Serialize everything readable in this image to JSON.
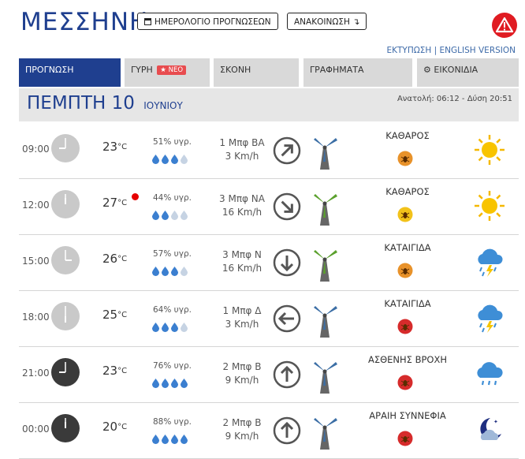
{
  "page": {
    "title": "ΜΕΣΣΗΝΗ",
    "calendar_button": "ΗΜΕΡΟΛΟΓΙΟ ΠΡΟΓΝΩΣΕΩΝ",
    "announcement_button": "ΑΝΑΚΟΙΝΩΣΗ",
    "print_link": "ΕΚΤΥΠΩΣΗ",
    "link_separator": "|",
    "english_link": "ENGLISH VERSION",
    "warning_icon": "warning-triangle-icon"
  },
  "tabs": [
    {
      "label": "ΠΡΟΓΝΩΣΗ",
      "active": true
    },
    {
      "label": "ΓΥΡΗ",
      "badge": "ΝΕΟ"
    },
    {
      "label": "ΣΚΟΝΗ"
    },
    {
      "label": "ΓΡΑΦΗΜΑΤΑ"
    },
    {
      "label": "ΕΙΚΟΝΙΔΙΑ",
      "icon": "gear-icon"
    }
  ],
  "day": {
    "title": "ΠΕΜΠΤΗ 10",
    "month": "ΙΟΥΝΙΟΥ",
    "sun_text": "Ανατολή: 06:12 - Δύση 20:51"
  },
  "rows": [
    {
      "time": "09:00",
      "temp": "23",
      "unit": "°C",
      "humidity": "51% υγρ.",
      "drops_filled": 3,
      "wind_force": "1 Μπφ ΒΑ",
      "wind_speed": "3 Km/h",
      "wind_dir": "ΒΑ",
      "condition": "ΚΑΘΑΡΟΣ",
      "bug_color": "#e8922a",
      "weather_icon": "sun-icon",
      "night": false,
      "hot": false,
      "turbine_color": "#3b6ea5"
    },
    {
      "time": "12:00",
      "temp": "27",
      "unit": "°C",
      "humidity": "44% υγρ.",
      "drops_filled": 2,
      "wind_force": "3 Μπφ ΝΑ",
      "wind_speed": "16 Km/h",
      "wind_dir": "ΝΑ",
      "condition": "ΚΑΘΑΡΟΣ",
      "bug_color": "#f2c21a",
      "weather_icon": "sun-icon",
      "night": false,
      "hot": true,
      "turbine_color": "#5aa02c"
    },
    {
      "time": "15:00",
      "temp": "26",
      "unit": "°C",
      "humidity": "57% υγρ.",
      "drops_filled": 3,
      "wind_force": "3 Μπφ Ν",
      "wind_speed": "16 Km/h",
      "wind_dir": "Ν",
      "condition": "ΚΑΤΑΙΓΙΔΑ",
      "bug_color": "#e8922a",
      "weather_icon": "thunderstorm-icon",
      "night": false,
      "hot": false,
      "turbine_color": "#5aa02c"
    },
    {
      "time": "18:00",
      "temp": "25",
      "unit": "°C",
      "humidity": "64% υγρ.",
      "drops_filled": 3,
      "wind_force": "1 Μπφ Δ",
      "wind_speed": "3 Km/h",
      "wind_dir": "Δ",
      "condition": "ΚΑΤΑΙΓΙΔΑ",
      "bug_color": "#d62b2b",
      "weather_icon": "thunderstorm-icon",
      "night": false,
      "hot": false,
      "turbine_color": "#3b6ea5"
    },
    {
      "time": "21:00",
      "temp": "23",
      "unit": "°C",
      "humidity": "76% υγρ.",
      "drops_filled": 4,
      "wind_force": "2 Μπφ Β",
      "wind_speed": "9 Km/h",
      "wind_dir": "Β",
      "condition": "ΑΣΘΕΝΗΣ ΒΡΟΧΗ",
      "bug_color": "#d62b2b",
      "weather_icon": "rain-icon",
      "night": true,
      "hot": false,
      "turbine_color": "#3b6ea5"
    },
    {
      "time": "00:00",
      "temp": "20",
      "unit": "°C",
      "humidity": "88% υγρ.",
      "drops_filled": 4,
      "wind_force": "2 Μπφ Β",
      "wind_speed": "9 Km/h",
      "wind_dir": "Β",
      "condition": "ΑΡΑΙΗ ΣΥΝΝΕΦΙΑ",
      "bug_color": "#d62b2b",
      "weather_icon": "night-cloud-icon",
      "night": true,
      "hot": false,
      "turbine_color": "#3b6ea5"
    }
  ]
}
